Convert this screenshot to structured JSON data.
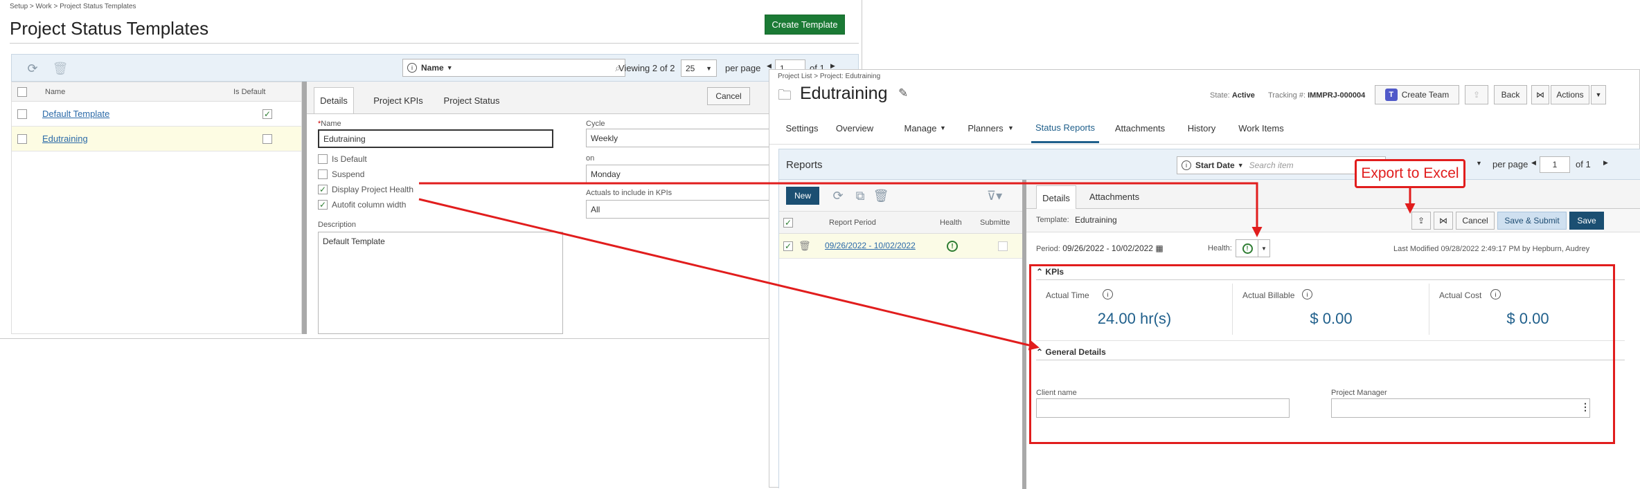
{
  "left": {
    "breadcrumb": "Setup > Work > Project Status Templates",
    "title": "Project Status Templates",
    "create_button": "Create Template",
    "search_field": "Name",
    "viewing_label": "Viewing",
    "viewing_range": "2 of 2",
    "page_size": "25",
    "per_page_label": "per page",
    "page_number": "1",
    "page_of": "of 1",
    "grid": {
      "col_name": "Name",
      "col_default": "Is Default",
      "rows": [
        {
          "name": "Default Template",
          "is_default": true
        },
        {
          "name": "Edutraining",
          "is_default": false
        }
      ]
    },
    "tabs": [
      "Details",
      "Project KPIs",
      "Project Status"
    ],
    "cancel_button": "Cancel",
    "form": {
      "name_required": "*",
      "name_label": "Name",
      "name_value": "Edutraining",
      "is_default_label": "Is Default",
      "suspend_label": "Suspend",
      "display_health_label": "Display Project Health",
      "autofit_label": "Autofit column width",
      "description_label": "Description",
      "description_value": "Default Template",
      "cycle_label": "Cycle",
      "cycle_value": "Weekly",
      "on_label": "on",
      "on_value": "Monday",
      "actuals_label": "Actuals to include in KPIs",
      "actuals_value": "All"
    }
  },
  "right": {
    "breadcrumb": "Project List > Project: Edutraining",
    "title": "Edutraining",
    "state_label": "State:",
    "state_value": "Active",
    "tracking_label": "Tracking #:",
    "tracking_value": "IMMPRJ-000004",
    "create_team_button": "Create Team",
    "back_button": "Back",
    "actions_button": "Actions",
    "nav": [
      "Settings",
      "Overview",
      "Manage",
      "Planners",
      "Status Reports",
      "Attachments",
      "History",
      "Work Items"
    ],
    "nav_active": "Status Reports",
    "reports_title": "Reports",
    "start_date_field": "Start Date",
    "search_placeholder": "Search item",
    "per_page_label": "per page",
    "page_number": "1",
    "page_of": "of 1",
    "new_button": "New",
    "list": {
      "col_period": "Report Period",
      "col_health": "Health",
      "col_submitted": "Submitte",
      "rows": [
        {
          "period": "09/26/2022 - 10/02/2022"
        }
      ]
    },
    "detail_tabs": [
      "Details",
      "Attachments"
    ],
    "template_label": "Template:",
    "template_value": "Edutraining",
    "cancel_button": "Cancel",
    "save_submit_button": "Save & Submit",
    "save_button": "Save",
    "period_label": "Period:",
    "period_value": "09/26/2022 - 10/02/2022",
    "health_label": "Health:",
    "last_modified": "Last Modified 09/28/2022 2:49:17 PM by Hepburn, Audrey",
    "kpis_title": "KPIs",
    "kpis": [
      {
        "label": "Actual Time",
        "value": "24.00 hr(s)"
      },
      {
        "label": "Actual Billable",
        "value": "$ 0.00"
      },
      {
        "label": "Actual Cost",
        "value": "$ 0.00"
      }
    ],
    "general_title": "General Details",
    "client_label": "Client name",
    "pm_label": "Project Manager"
  },
  "callout": "Export to Excel",
  "colors": {
    "annotation": "#e11d1d",
    "accent": "#1f5f8b",
    "green": "#1b7a35"
  }
}
